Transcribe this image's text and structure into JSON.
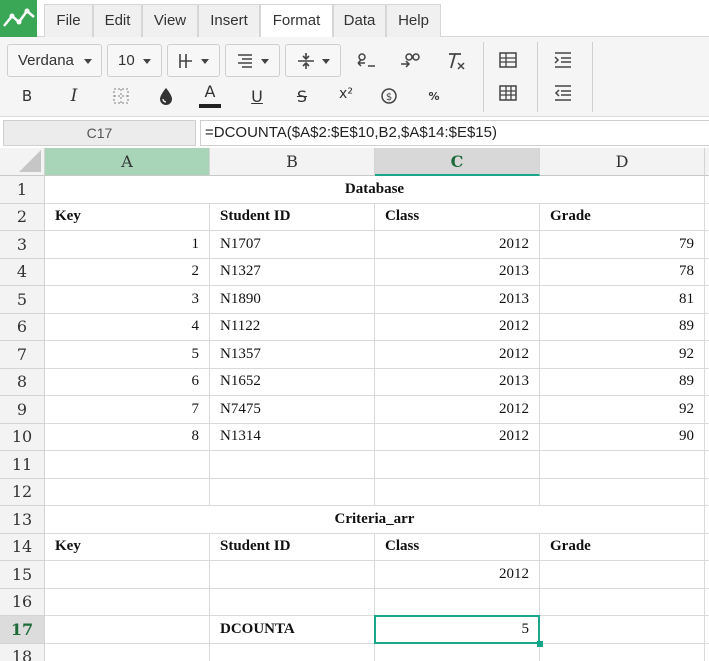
{
  "menu": {
    "items": [
      "File",
      "Edit",
      "View",
      "Insert",
      "Format",
      "Data",
      "Help"
    ],
    "active": "Format"
  },
  "toolbar": {
    "font_family": "Verdana",
    "font_size": "10",
    "icons": [
      "borders-icon",
      "align-icon",
      "valign-icon",
      "indent-left-icon",
      "indent-right-icon",
      "clear-format-icon",
      "bold-icon",
      "italic-icon",
      "cell-borders-icon",
      "fill-color-icon",
      "text-color-icon",
      "underline-icon",
      "strikethrough-icon",
      "superscript-icon",
      "currency-icon",
      "percent-icon",
      "insert-table-icon",
      "table-grid-icon",
      "increase-indent-icon",
      "decrease-indent-icon"
    ],
    "bold_label": "B",
    "italic_label": "I",
    "text_color_label": "A",
    "underline_label": "U",
    "strike_label": "S",
    "superscript_label": "x²",
    "percent_label": "%",
    "accent": "#3aa757"
  },
  "formula_bar": {
    "cell_ref": "C17",
    "formula": "=DCOUNTA($A$2:$E$10,B2,$A$14:$E$15)"
  },
  "columns": [
    "A",
    "B",
    "C",
    "D"
  ],
  "rows": {
    "1": {
      "merged": "Database"
    },
    "2": {
      "A": "Key",
      "B": "Student ID",
      "C": "Class",
      "D": "Grade"
    },
    "3": {
      "A": "1",
      "B": "N1707",
      "C": "2012",
      "D": "79"
    },
    "4": {
      "A": "2",
      "B": "N1327",
      "C": "2013",
      "D": "78"
    },
    "5": {
      "A": "3",
      "B": "N1890",
      "C": "2013",
      "D": "81"
    },
    "6": {
      "A": "4",
      "B": "N1122",
      "C": "2012",
      "D": "89"
    },
    "7": {
      "A": "5",
      "B": "N1357",
      "C": "2012",
      "D": "92"
    },
    "8": {
      "A": "6",
      "B": "N1652",
      "C": "2013",
      "D": "89"
    },
    "9": {
      "A": "7",
      "B": "N7475",
      "C": "2012",
      "D": "92"
    },
    "10": {
      "A": "8",
      "B": "N1314",
      "C": "2012",
      "D": "90"
    },
    "11": {},
    "12": {},
    "13": {
      "merged": "Criteria_arr"
    },
    "14": {
      "A": "Key",
      "B": "Student ID",
      "C": "Class",
      "D": "Grade"
    },
    "15": {
      "C": "2012"
    },
    "16": {},
    "17": {
      "B": "DCOUNTA",
      "C": "5"
    },
    "18": {}
  },
  "row_numbers": [
    "1",
    "2",
    "3",
    "4",
    "5",
    "6",
    "7",
    "8",
    "9",
    "10",
    "11",
    "12",
    "13",
    "14",
    "15",
    "16",
    "17",
    "18"
  ],
  "selection": {
    "active_cell": "C17",
    "active_color": "#1aa68a"
  }
}
